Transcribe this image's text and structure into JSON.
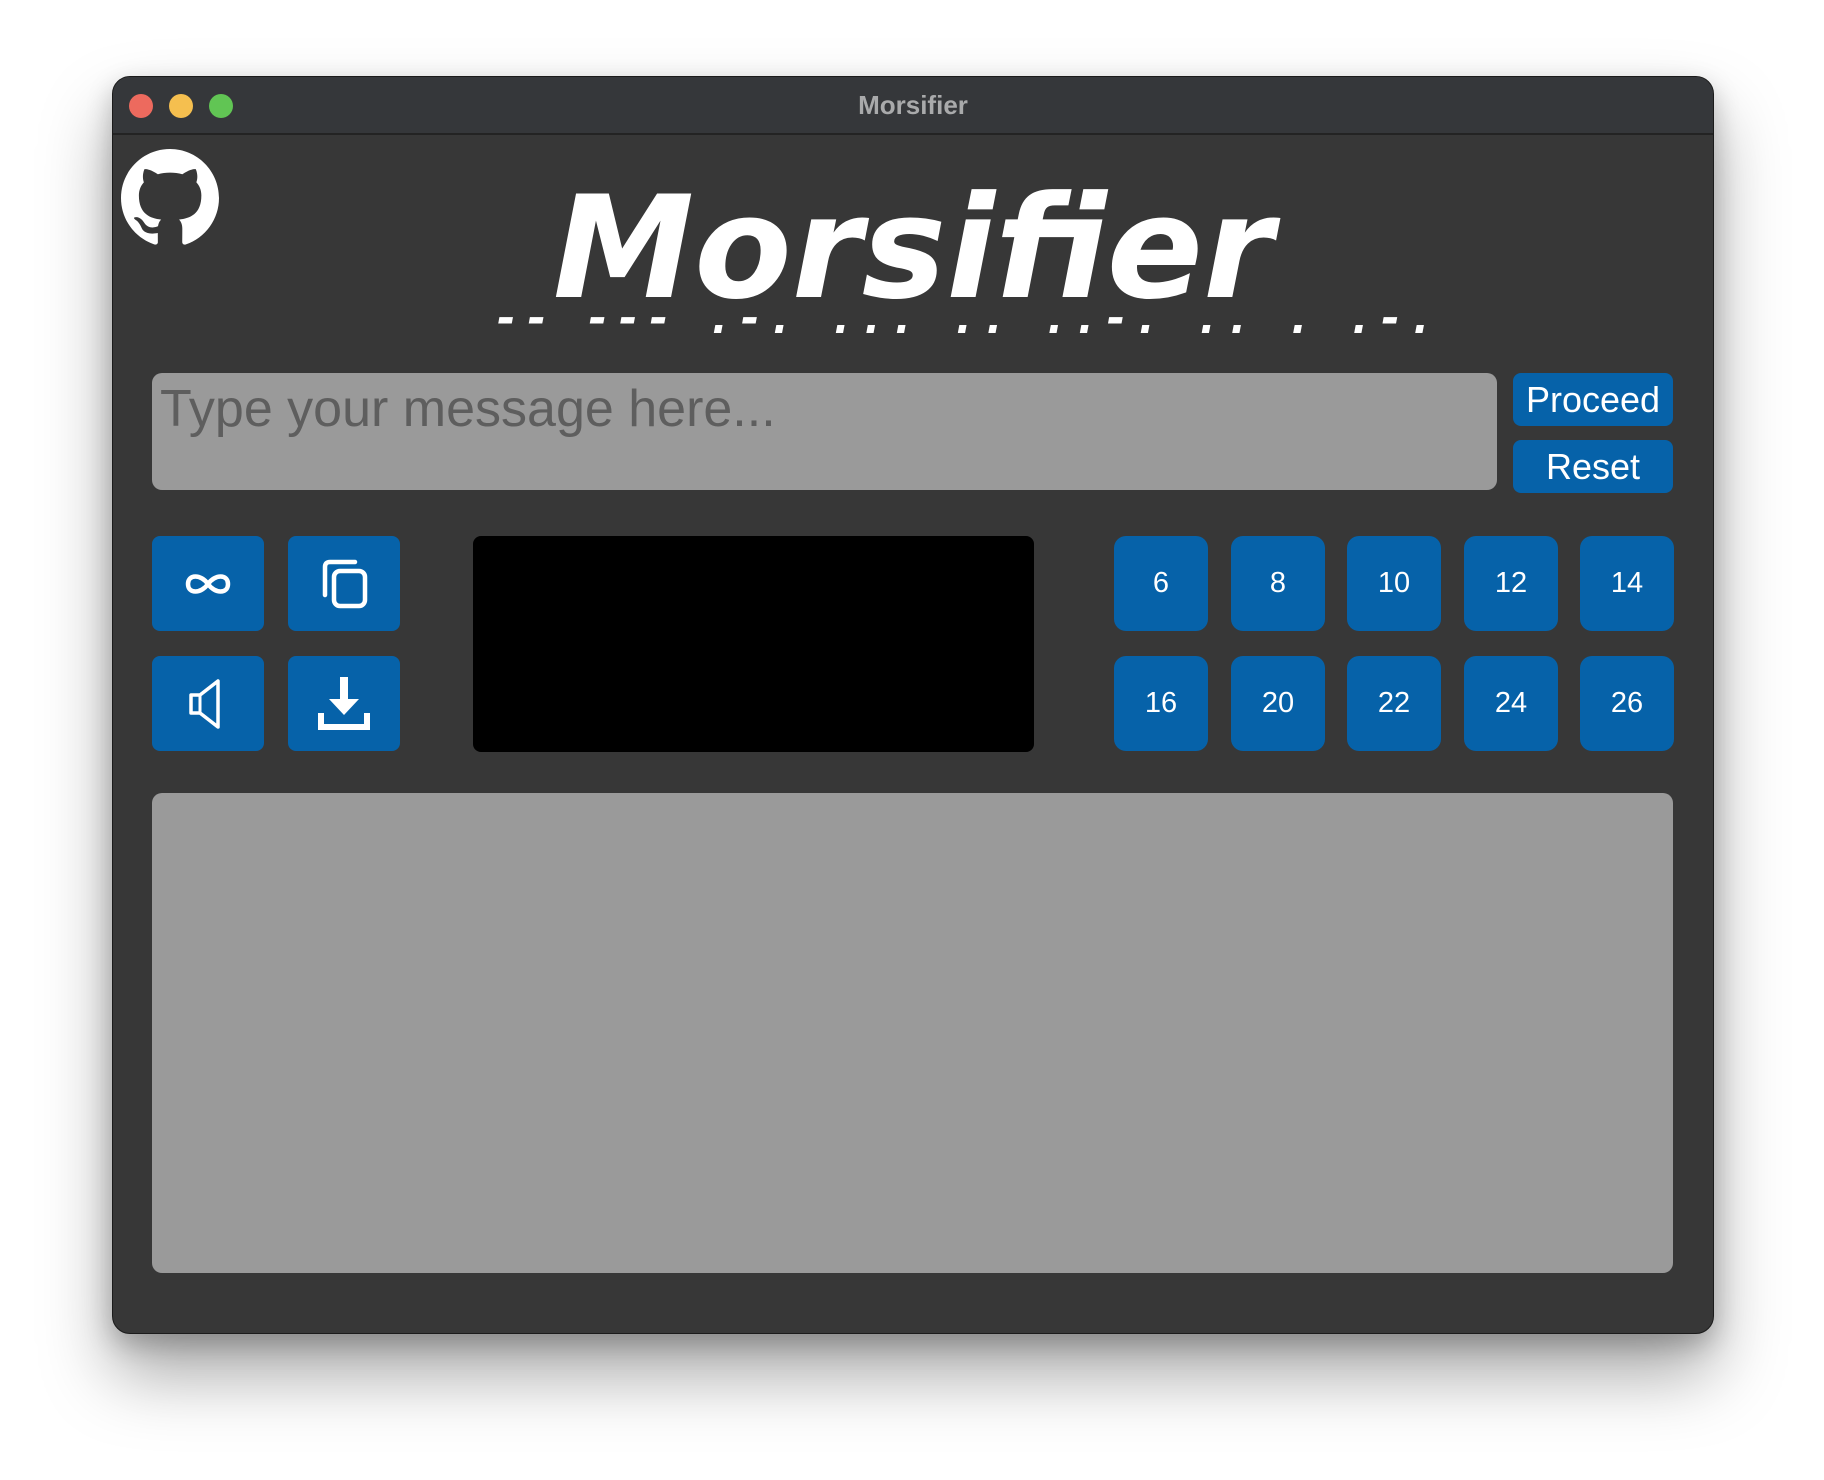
{
  "window": {
    "title": "Morsifier"
  },
  "header": {
    "logo_text": "Morsifier",
    "morse_text": "-- --- .-. ... .. ..-. .. . .-."
  },
  "input": {
    "placeholder": "Type your message here...",
    "value": ""
  },
  "actions": {
    "proceed_label": "Proceed",
    "reset_label": "Reset"
  },
  "tools": [
    {
      "icon": "infinity-icon"
    },
    {
      "icon": "copy-icon"
    },
    {
      "icon": "speaker-icon"
    },
    {
      "icon": "download-icon"
    }
  ],
  "font_sizes": {
    "row1": [
      "6",
      "8",
      "10",
      "12",
      "14"
    ],
    "row2": [
      "16",
      "20",
      "22",
      "24",
      "26"
    ]
  },
  "colors": {
    "window_bg": "#373737",
    "button_blue": "#0662a9",
    "input_bg": "#9a9a9a",
    "display_bg": "#000000"
  },
  "output": {
    "text": ""
  }
}
